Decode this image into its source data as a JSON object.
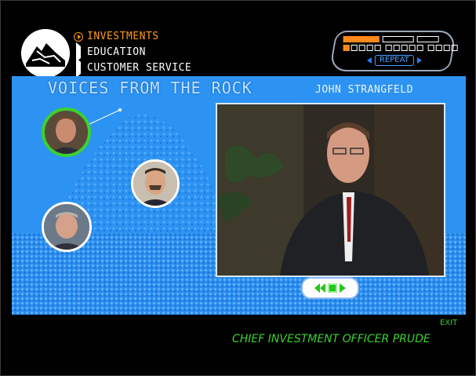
{
  "nav": {
    "items": [
      {
        "label": "INVESTMENTS",
        "active": true
      },
      {
        "label": "EDUCATION",
        "active": false
      },
      {
        "label": "CUSTOMER SERVICE",
        "active": false
      }
    ]
  },
  "progress": {
    "segments_top_filled": 1,
    "segments_top_total": 3,
    "squares_filled": 1,
    "squares_total": 14,
    "repeat_label": "REPEAT"
  },
  "scene": {
    "title": "VOICES FROM THE ROCK",
    "speaker": "JOHN STRANGFELD"
  },
  "footer": {
    "exit_label": "EXIT",
    "caption": "CHIEF INVESTMENT OFFICER PRUDE"
  },
  "colors": {
    "accent_orange": "#ff9a1a",
    "accent_green": "#3bd12f",
    "scene_blue": "#2d93f2"
  },
  "icons": [
    "logo-rock-icon",
    "play-circle-icon",
    "triangle-right-icon",
    "arrow-left-icon",
    "arrow-right-icon",
    "rewind-icon",
    "stop-icon",
    "play-icon"
  ]
}
